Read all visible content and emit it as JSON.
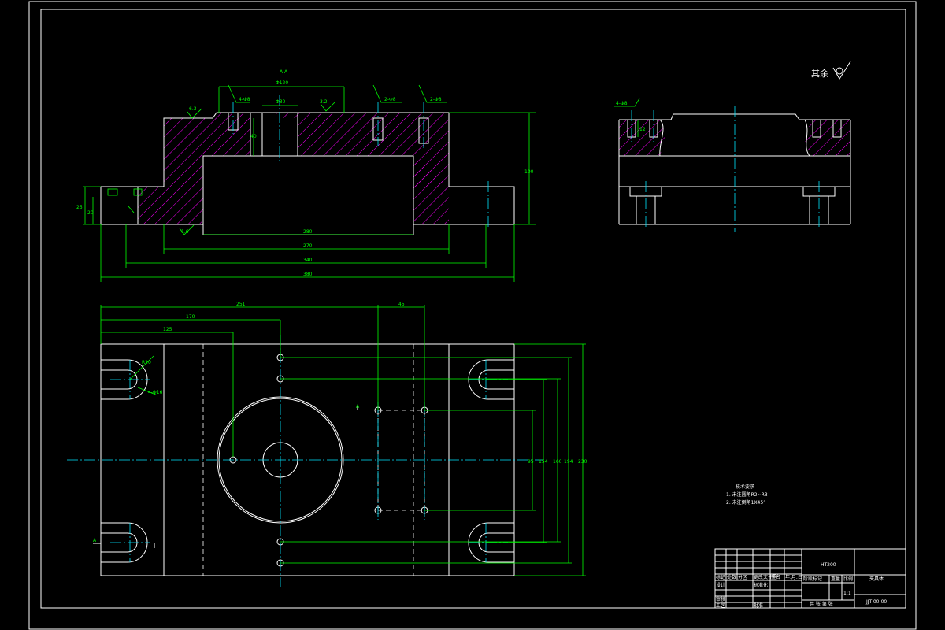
{
  "surface_symbol": {
    "label": "其余"
  },
  "front_view": {
    "dim_top_diameter": "Φ120",
    "dim_bore": "Φ30",
    "dim_hole_left": "4-Φ8",
    "dim_hole_right1": "2-Φ8",
    "dim_hole_right2": "2-Φ8",
    "dim_depth": "40",
    "dim_height": "100",
    "dim_left_1": "25",
    "dim_left_2": "20",
    "dim_280": "280",
    "dim_270": "270",
    "dim_340": "340",
    "dim_380": "380",
    "roughness_1": "6.3",
    "roughness_2": "3.2",
    "roughness_3": "1.6",
    "label_aa": "A-A"
  },
  "side_view": {
    "dim_hole": "4-Φ8",
    "dim_depth": "12"
  },
  "top_view": {
    "dim_251": "251",
    "dim_45": "45",
    "dim_170": "170",
    "dim_125": "125",
    "dim_r20": "R20",
    "dim_slot": "4-Φ16",
    "dim_95": "95",
    "dim_154": "154",
    "dim_160": "160",
    "dim_194": "194",
    "dim_230": "230",
    "section_a_top": "A",
    "section_a_bottom": "A"
  },
  "tech_notes": {
    "title": "技术要求",
    "line1": "1. 未注圆角R2~R3",
    "line2": "2. 未注倒角1X45°"
  },
  "title_block": {
    "material": "HT200",
    "drawing_name": "夹具体",
    "drawing_number": "JJT-00-00",
    "scale": "1:1",
    "row_labels": [
      "标记",
      "处数",
      "分区",
      "更改文件号",
      "签名",
      "年.月.日"
    ],
    "design": "设计",
    "standardize": "标准化",
    "review": "审核",
    "process": "工艺",
    "approve": "批准",
    "stage_mark": "阶段标记",
    "weight": "重量",
    "ratio": "比例",
    "sheet": "共  张  第  张"
  }
}
